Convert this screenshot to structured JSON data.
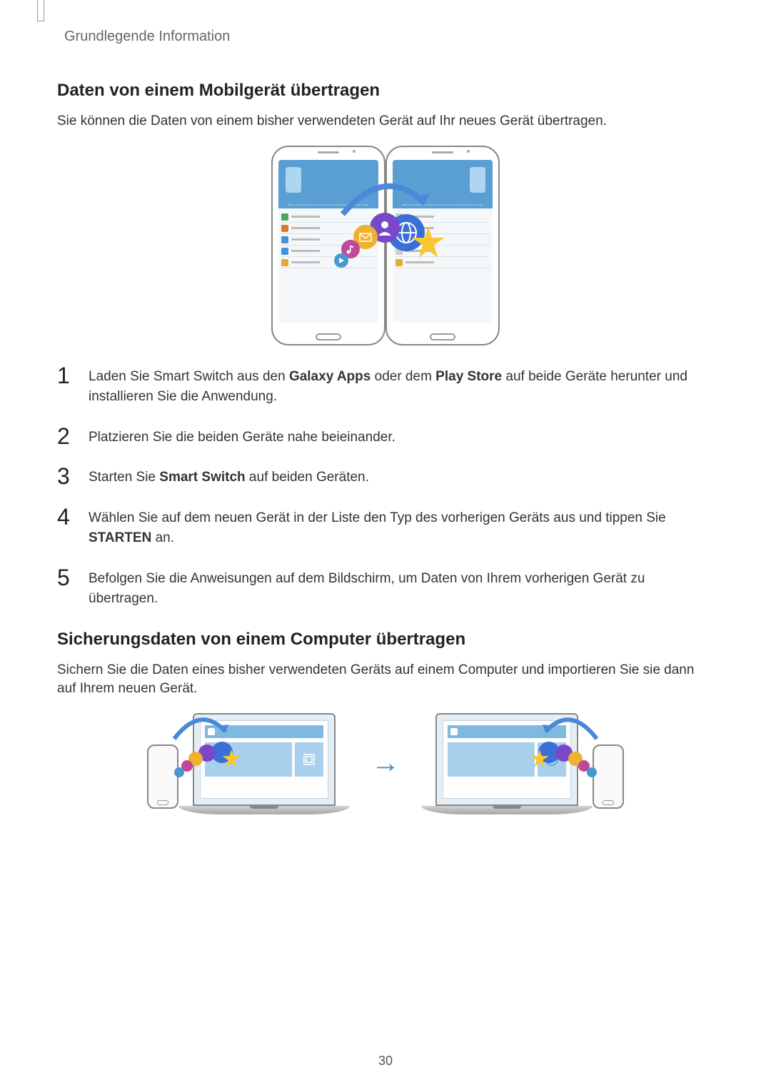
{
  "breadcrumb": "Grundlegende Information",
  "section1": {
    "heading": "Daten von einem Mobilgerät übertragen",
    "intro": "Sie können die Daten von einem bisher verwendeten Gerät auf Ihr neues Gerät übertragen."
  },
  "steps": [
    {
      "num": "1",
      "parts": [
        "Laden Sie Smart Switch aus den ",
        "Galaxy Apps",
        " oder dem ",
        "Play Store",
        " auf beide Geräte herunter und installieren Sie die Anwendung."
      ]
    },
    {
      "num": "2",
      "parts": [
        "Platzieren Sie die beiden Geräte nahe beieinander."
      ]
    },
    {
      "num": "3",
      "parts": [
        "Starten Sie ",
        "Smart Switch",
        " auf beiden Geräten."
      ]
    },
    {
      "num": "4",
      "parts": [
        "Wählen Sie auf dem neuen Gerät in der Liste den Typ des vorherigen Geräts aus und tippen Sie ",
        "STARTEN",
        " an."
      ]
    },
    {
      "num": "5",
      "parts": [
        "Befolgen Sie die Anweisungen auf dem Bildschirm, um Daten von Ihrem vorherigen Gerät zu übertragen."
      ]
    }
  ],
  "section2": {
    "heading": "Sicherungsdaten von einem Computer übertragen",
    "intro": "Sichern Sie die Daten eines bisher verwendeten Geräts auf einem Computer und importieren Sie sie dann auf Ihrem neuen Gerät."
  },
  "page_number": "30",
  "icons": {
    "globe": "globe-icon",
    "contact": "contact-icon",
    "mail": "mail-icon",
    "music": "music-icon",
    "play": "play-icon",
    "star": "star-icon",
    "arrow": "arrow-right-icon"
  }
}
